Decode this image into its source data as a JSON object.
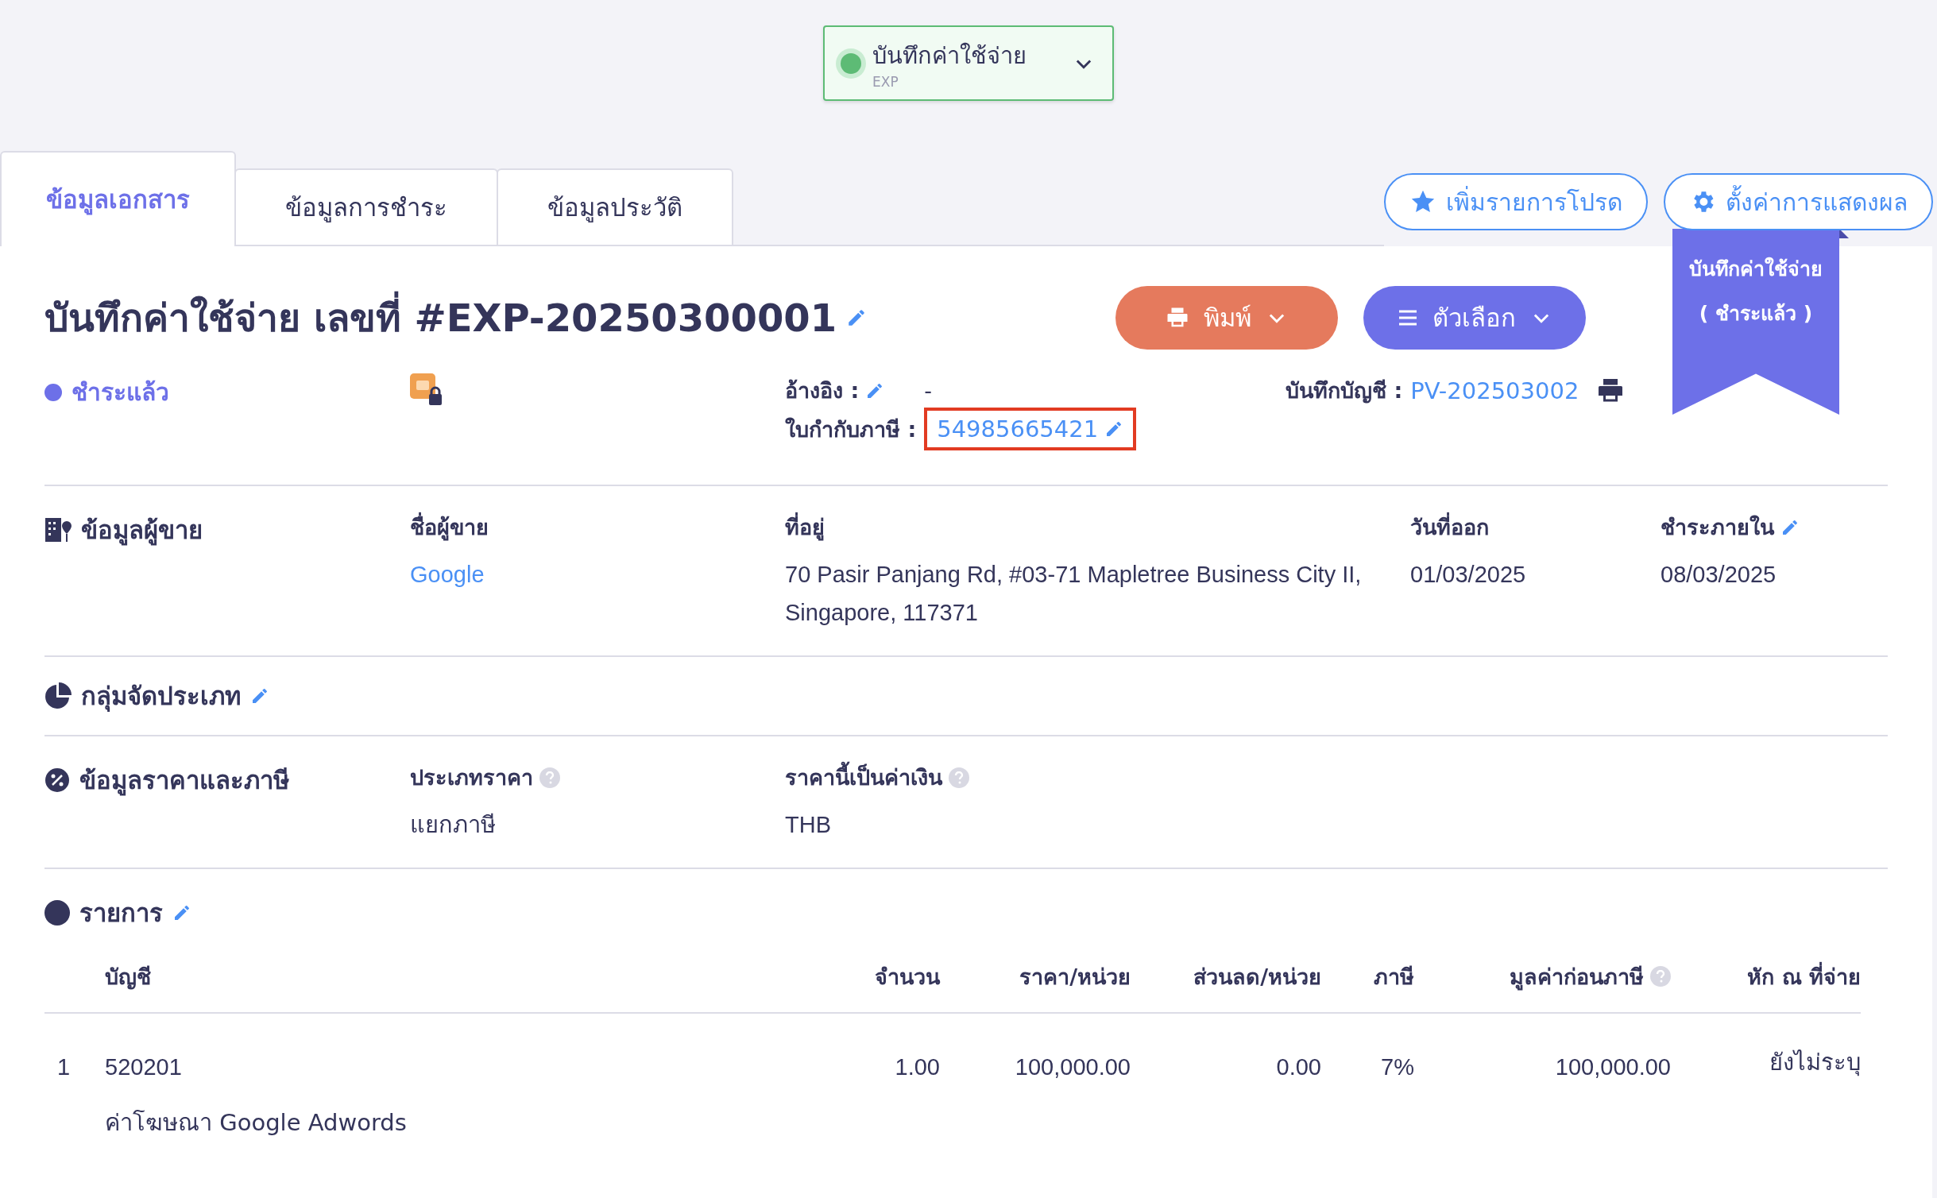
{
  "doc_type_selector": {
    "label": "บันทึกค่าใช้จ่าย",
    "code": "EXP"
  },
  "tabs": [
    {
      "label": "ข้อมูลเอกสาร",
      "selected": true
    },
    {
      "label": "ข้อมูลการชำระ",
      "selected": false
    },
    {
      "label": "ข้อมูลประวัติ",
      "selected": false
    }
  ],
  "actions": [
    {
      "label": "เพิ่มรายการโปรด",
      "kind": "star"
    },
    {
      "label": "ตั้งค่าการแสดงผล",
      "kind": "gear"
    }
  ],
  "title": "บันทึกค่าใช้จ่าย เลขที่ #EXP-20250300001",
  "buttons": [
    {
      "label": "พิมพ์",
      "kind": "print"
    },
    {
      "label": "ตัวเลือก",
      "kind": "options"
    }
  ],
  "ribbon": {
    "line1": "บันทึกค่าใช้จ่าย",
    "line2": "( ชำระแล้ว )"
  },
  "status": {
    "label": "ชำระแล้ว",
    "color": "#6d70e8"
  },
  "reference": {
    "label": "อ้างอิง :",
    "value": "-"
  },
  "tax_invoice": {
    "label": "ใบกำกับภาษี :",
    "value": "54985665421",
    "highlighted": true
  },
  "journal": {
    "label": "บันทึกบัญชี :",
    "value": "PV-202503002"
  },
  "vendor": {
    "heading": "ข้อมูลผู้ขาย",
    "fields": [
      {
        "label": "ชื่อผู้ขาย",
        "value": "Google",
        "kind": "link",
        "editable": false
      },
      {
        "label": "ที่อยู่",
        "value": "70 Pasir Panjang Rd, #03-71 Mapletree Business City II, Singapore, 117371",
        "kind": "text",
        "editable": false
      },
      {
        "label": "วันที่ออก",
        "value": "01/03/2025",
        "kind": "text",
        "editable": false
      },
      {
        "label": "ชำระภายใน",
        "value": "08/03/2025",
        "kind": "text",
        "editable": true
      }
    ]
  },
  "category": {
    "heading": "กลุ่มจัดประเภท",
    "editable": true
  },
  "pricing": {
    "heading": "ข้อมูลราคาและภาษี",
    "fields": [
      {
        "label": "ประเภทราคา",
        "value": "แยกภาษี",
        "help": true
      },
      {
        "label": "ราคานี้เป็นค่าเงิน",
        "value": "THB",
        "help": true
      }
    ]
  },
  "items": {
    "heading": "รายการ",
    "editable": true,
    "columns": [
      {
        "label": "บัญชี",
        "help": false
      },
      {
        "label": "จำนวน",
        "help": false
      },
      {
        "label": "ราคา/หน่วย",
        "help": false
      },
      {
        "label": "ส่วนลด/หน่วย",
        "help": false
      },
      {
        "label": "ภาษี",
        "help": false
      },
      {
        "label": "มูลค่าก่อนภาษี",
        "help": true
      },
      {
        "label": "หัก ณ ที่จ่าย",
        "help": false
      }
    ],
    "rows": [
      {
        "index": "1",
        "account": "520201",
        "quantity": "1.00",
        "unit_price": "100,000.00",
        "discount": "0.00",
        "tax": "7%",
        "pre_tax": "100,000.00",
        "withholding": "ยังไม่ระบุ",
        "description": "ค่าโฆษณา Google Adwords"
      }
    ]
  }
}
